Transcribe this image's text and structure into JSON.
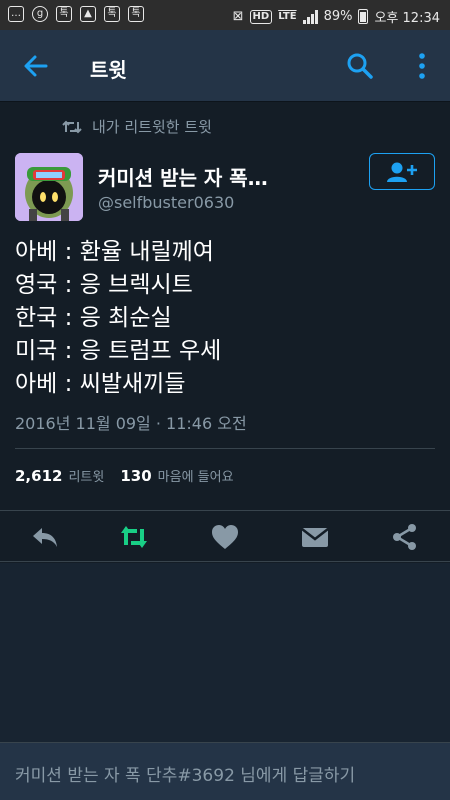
{
  "status_bar": {
    "left_icons": [
      "chat-icon",
      "g-icon",
      "talk-icon",
      "gallery-icon",
      "talk-icon",
      "talk-icon"
    ],
    "hd": "HD",
    "network": "LTE",
    "battery": "89%",
    "time": "오후 12:34"
  },
  "header": {
    "title": "트윗"
  },
  "tweet": {
    "retweet_context": "내가 리트윗한 트윗",
    "author_name": "커미션 받는 자 폭…",
    "author_handle": "@selfbuster0630",
    "lines": [
      "아베 : 환율 내릴께여",
      "영국 : 응 브렉시트",
      "한국 : 응 최순실",
      "미국 : 응 트럼프 우세",
      "아베 : 씨발새끼들"
    ],
    "timestamp": "2016년 11월 09일 · 11:46 오전",
    "retweet_count": "2,612",
    "retweet_label": "리트윗",
    "like_count": "130",
    "like_label": "마음에 들어요"
  },
  "reply_bar": {
    "placeholder": "커미션 받는 자 폭 단추#3692 님에게 답글하기"
  },
  "colors": {
    "background": "#141d26",
    "header": "#243447",
    "accent": "#1da1f2",
    "retweet_green": "#19cf86",
    "muted": "#8899a6"
  }
}
